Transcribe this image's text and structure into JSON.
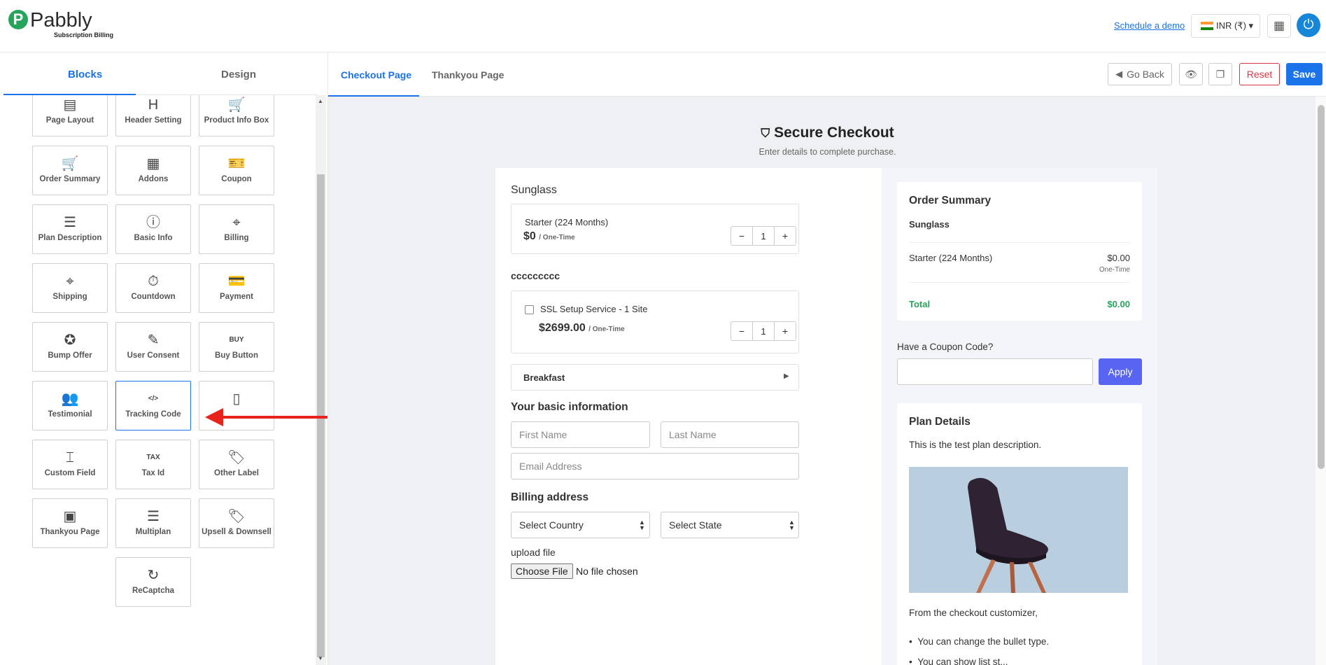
{
  "header": {
    "logo_mark": "P",
    "logo_name": "Pabbly",
    "logo_sub": "Subscription Billing",
    "schedule_demo": "Schedule a demo",
    "currency": "INR (₹) ▾",
    "apps_icon": "grid-icon",
    "power_icon": "power-icon"
  },
  "sidebar": {
    "tabs": [
      "Blocks",
      "Design"
    ],
    "blocks": [
      {
        "label": "Page Layout",
        "icon": "▤"
      },
      {
        "label": "Header Setting",
        "icon": "H"
      },
      {
        "label": "Product Info Box",
        "icon": "🛒"
      },
      {
        "label": "Order Summary",
        "icon": "🛒"
      },
      {
        "label": "Addons",
        "icon": "▦"
      },
      {
        "label": "Coupon",
        "icon": "🎫"
      },
      {
        "label": "Plan Description",
        "icon": "☰"
      },
      {
        "label": "Basic Info",
        "icon": "ⓘ"
      },
      {
        "label": "Billing",
        "icon": "⌖"
      },
      {
        "label": "Shipping",
        "icon": "⌖"
      },
      {
        "label": "Countdown",
        "icon": "⏱"
      },
      {
        "label": "Payment",
        "icon": "💳"
      },
      {
        "label": "Bump Offer",
        "icon": "✪"
      },
      {
        "label": "User Consent",
        "icon": "✎"
      },
      {
        "label": "Buy Button",
        "icon": "BUY"
      },
      {
        "label": "Testimonial",
        "icon": "👥"
      },
      {
        "label": "Tracking Code",
        "icon": "</>"
      },
      {
        "label": "",
        "icon": "▯"
      },
      {
        "label": "Custom Field",
        "icon": "⌶"
      },
      {
        "label": "Tax Id",
        "icon": "TAX"
      },
      {
        "label": "Other Label",
        "icon": "🏷"
      },
      {
        "label": "Thankyou Page",
        "icon": "▣"
      },
      {
        "label": "Multiplan",
        "icon": "☰"
      },
      {
        "label": "Upsell & Downsell",
        "icon": "🏷"
      },
      {
        "label": "ReCaptcha",
        "icon": "↻"
      }
    ]
  },
  "main": {
    "tabs": [
      "Checkout Page",
      "Thankyou Page"
    ],
    "buttons": {
      "go_back": "Go Back",
      "reset": "Reset",
      "save": "Save"
    },
    "title": "Secure Checkout",
    "subtitle": "Enter details to complete purchase.",
    "product_name": "Sunglass",
    "plan": {
      "name": "Starter (224 Months)",
      "price": "$0",
      "period": "/ One-Time",
      "qty": "1"
    },
    "addon_group": "ccccccccc",
    "addon": {
      "name": "SSL Setup Service - 1 Site",
      "price": "$2699.00",
      "period": "/ One-Time",
      "qty": "1"
    },
    "accordion": "Breakfast",
    "basic_info_heading": "Your basic information",
    "first_name": "First Name",
    "last_name": "Last Name",
    "email": "Email Address",
    "billing_heading": "Billing address",
    "country": "Select Country",
    "state": "Select State",
    "upload_label": "upload file",
    "choose_file": "Choose File",
    "no_file": "No file chosen",
    "order_summary": {
      "heading": "Order Summary",
      "product": "Sunglass",
      "plan": "Starter (224 Months)",
      "amount": "$0.00",
      "period": "One-Time",
      "total_label": "Total",
      "total": "$0.00"
    },
    "coupon": {
      "label": "Have a Coupon Code?",
      "apply": "Apply"
    },
    "plan_details": {
      "heading": "Plan Details",
      "description": "This is the test plan description.",
      "customizer_text": "From the checkout customizer,",
      "bullet1": "You can change the bullet type.",
      "bullet2": "You can show list st..."
    }
  }
}
